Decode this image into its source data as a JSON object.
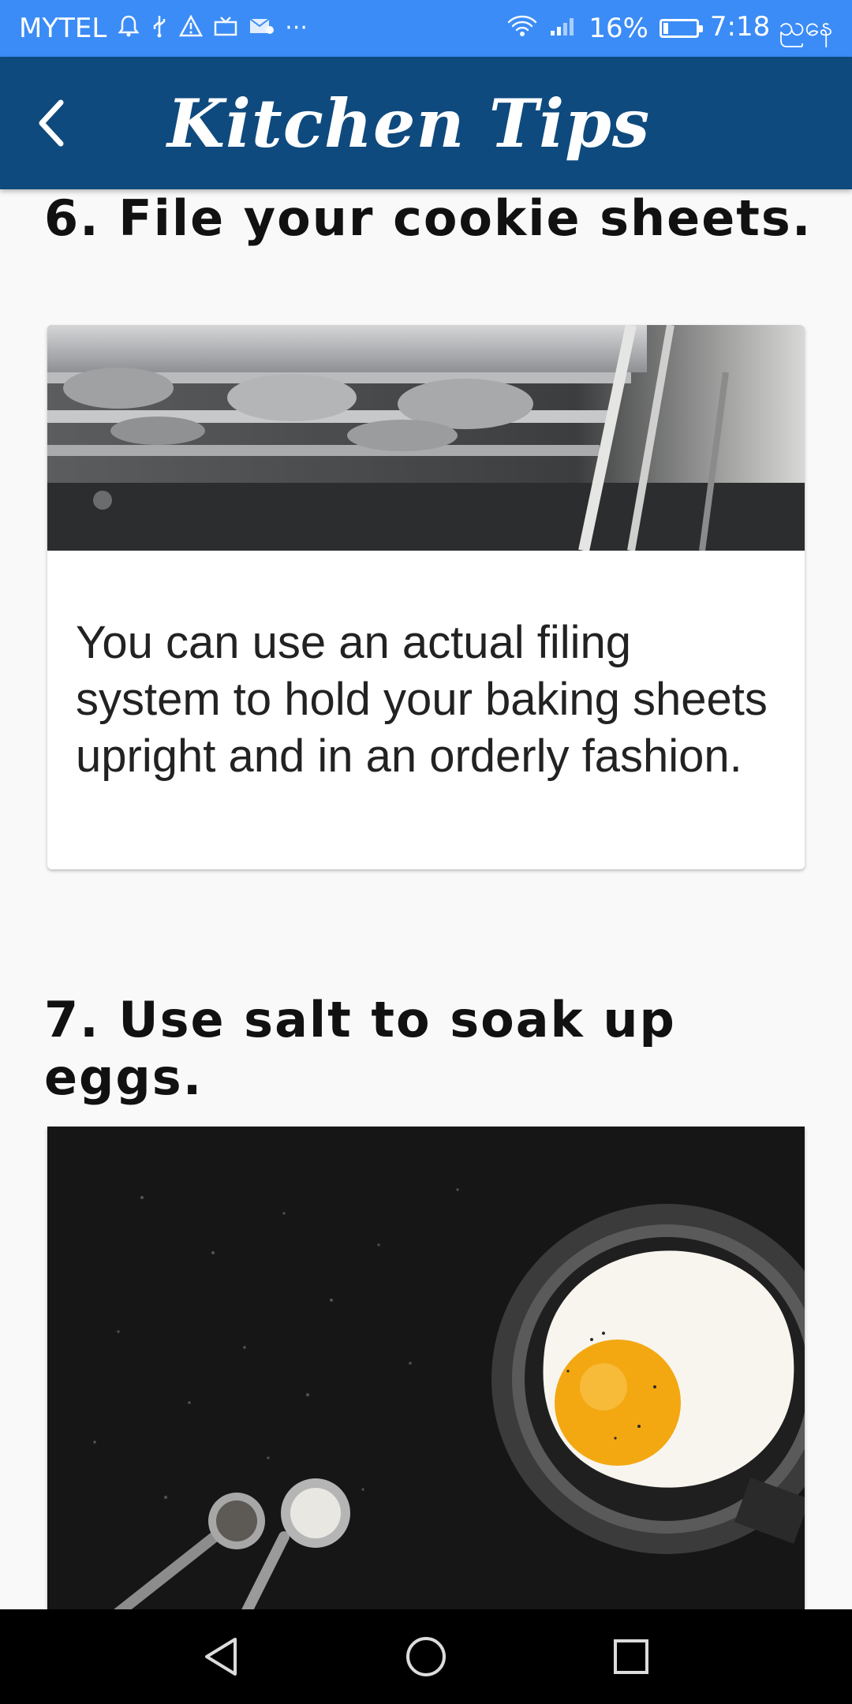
{
  "status_bar": {
    "carrier": "MYTEL",
    "icons_left": [
      "notification-bell-icon",
      "usb-icon",
      "warning-icon",
      "screen-icon",
      "mail-icon",
      "more-icon"
    ],
    "more": "···",
    "battery_percent": "16%",
    "battery_level": 0.16,
    "time": "7:18 ညနေ"
  },
  "app_bar": {
    "title": "Kitchen Tips",
    "back_icon": "back-arrow-icon",
    "background": "#0e4a7e"
  },
  "tips": [
    {
      "heading": "6. File your cookie sheets.",
      "image": "stacked-baking-pans-photo",
      "body": "You can use an actual filing system to hold your baking sheets upright and in an orderly fashion."
    },
    {
      "heading": "7. Use salt to soak up eggs.",
      "image": "fried-egg-in-pan-photo"
    }
  ],
  "nav_bar": {
    "buttons": [
      "back-triangle-icon",
      "home-circle-icon",
      "recents-square-icon"
    ]
  },
  "colors": {
    "status_bar": "#3b8cf6",
    "app_bar": "#0e4a7e",
    "page_background": "#f9f9f9"
  }
}
